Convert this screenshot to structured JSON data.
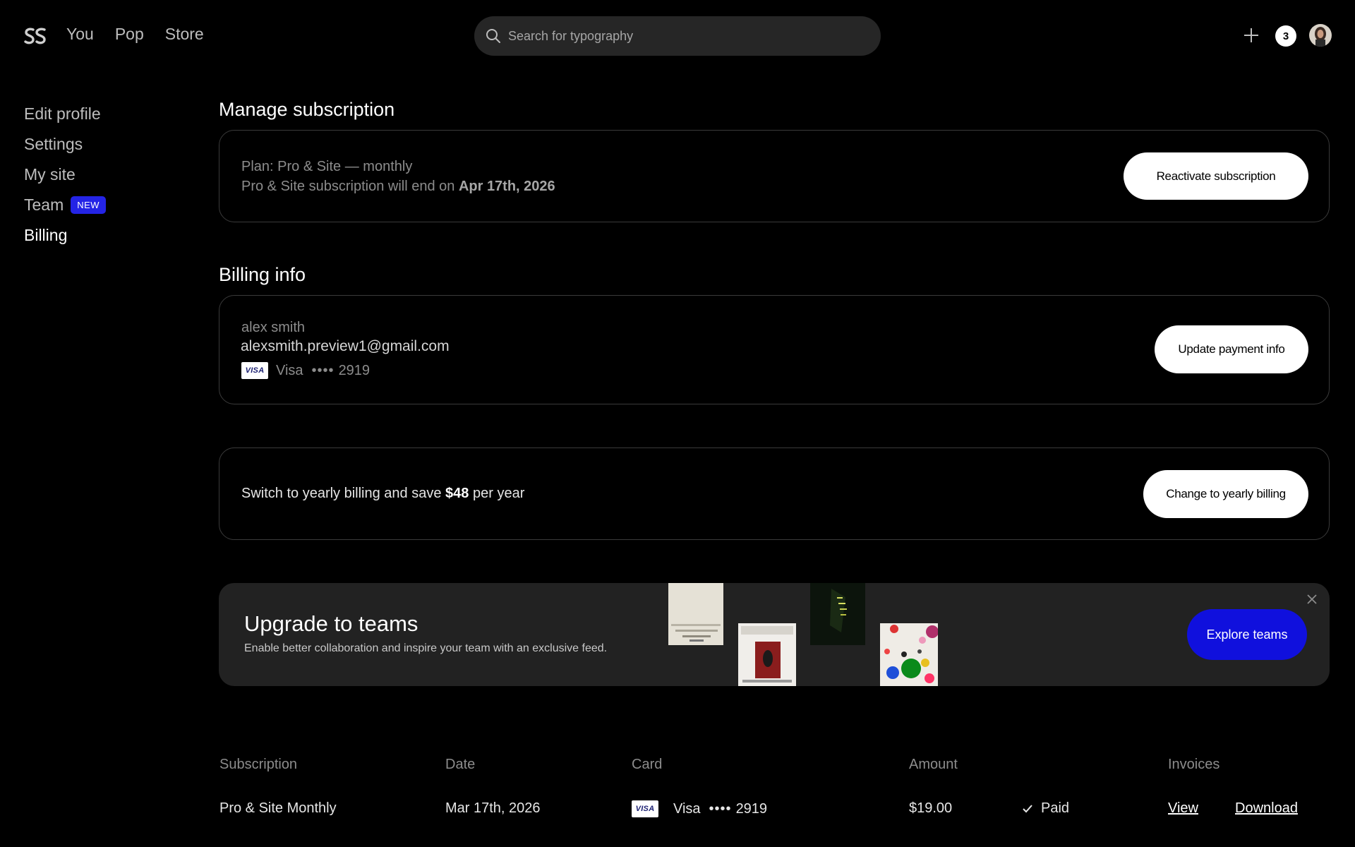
{
  "header": {
    "nav": [
      "You",
      "Pop",
      "Store"
    ],
    "search_placeholder": "Search for typography",
    "notification_count": "3"
  },
  "sidebar": {
    "items": [
      {
        "label": "Edit profile"
      },
      {
        "label": "Settings"
      },
      {
        "label": "My site"
      },
      {
        "label": "Team",
        "badge": "NEW"
      },
      {
        "label": "Billing",
        "active": true
      }
    ]
  },
  "subscription": {
    "title": "Manage subscription",
    "plan": "Plan: Pro & Site — monthly",
    "end_prefix": "Pro & Site subscription will end on",
    "end_date": "Apr 17th, 2026",
    "button": "Reactivate subscription"
  },
  "billing": {
    "title": "Billing info",
    "name": "alex smith",
    "email": "alexsmith.preview1@gmail.com",
    "card_brand_logo": "VISA",
    "card_brand": "Visa",
    "card_dots": "••••",
    "card_last4": "2919",
    "button": "Update payment info"
  },
  "yearly": {
    "prefix": "Switch to yearly billing and save",
    "amount": "$48",
    "suffix": "per year",
    "button": "Change to yearly billing"
  },
  "banner": {
    "title": "Upgrade to teams",
    "subtitle": "Enable better collaboration and inspire your team with an exclusive feed.",
    "button": "Explore teams"
  },
  "history": {
    "headers": [
      "Subscription",
      "Date",
      "Card",
      "Amount",
      "Invoices"
    ],
    "rows": [
      {
        "subscription": "Pro & Site Monthly",
        "date": "Mar 17th, 2026",
        "card_logo": "VISA",
        "card_brand": "Visa",
        "card_dots": "••••",
        "card_last4": "2919",
        "amount": "$19.00",
        "status": "Paid",
        "view": "View",
        "download": "Download"
      }
    ]
  },
  "colors": {
    "accent_blue": "#1010dd",
    "badge_blue": "#2424e6",
    "background": "#000000",
    "card_border": "#3a3a3a"
  }
}
